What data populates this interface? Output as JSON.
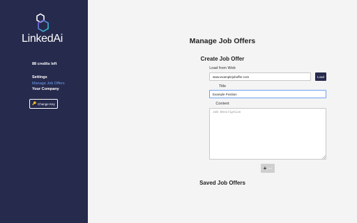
{
  "sidebar": {
    "brand": "LinkedAi",
    "credits": "88 credits left",
    "nav": [
      {
        "label": "Settings"
      },
      {
        "label": "Manage Job Offers"
      },
      {
        "label": "Your Company"
      }
    ],
    "change_key_label": "Change Key",
    "colors": {
      "background": "#262a4d",
      "active_link": "#6aa0f0"
    }
  },
  "main": {
    "page_title": "Manage Job Offers",
    "create_title": "Create Job Offer",
    "load_from_web_label": "Load from Web",
    "url_value": "www.examplejoboffer.com",
    "load_button_label": "Load",
    "title_label": "Title",
    "title_value": "Example Position",
    "content_label": "Content",
    "content_placeholder": "Job Description",
    "add_button_label": "Add",
    "saved_title": "Saved Job Offers"
  }
}
